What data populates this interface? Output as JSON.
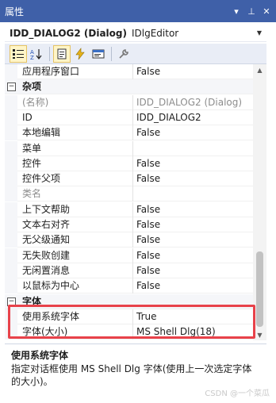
{
  "window": {
    "title": "属性",
    "controls": [
      "▾",
      "⊥",
      "✕"
    ]
  },
  "object_combo": {
    "object_name": "IDD_DIALOG2 (Dialog)",
    "class_name": "IDlgEditor"
  },
  "toolbar": {
    "buttons": [
      "categorized-icon",
      "alphabetical-icon",
      "properties-icon",
      "events-icon",
      "messages-icon",
      "property-pages-icon"
    ],
    "active_index": 2
  },
  "properties": [
    {
      "type": "prop",
      "name": "应用程序窗口",
      "value": "False"
    },
    {
      "type": "cat",
      "name": "杂项"
    },
    {
      "type": "prop",
      "name": "(名称)",
      "value": "IDD_DIALOG2 (Dialog)",
      "disabled": true
    },
    {
      "type": "prop",
      "name": "ID",
      "value": "IDD_DIALOG2"
    },
    {
      "type": "prop",
      "name": "本地编辑",
      "value": "False"
    },
    {
      "type": "prop",
      "name": "菜单",
      "value": ""
    },
    {
      "type": "prop",
      "name": "控件",
      "value": "False"
    },
    {
      "type": "prop",
      "name": "控件父项",
      "value": "False"
    },
    {
      "type": "prop",
      "name": "类名",
      "value": "",
      "disabled": true
    },
    {
      "type": "prop",
      "name": "上下文帮助",
      "value": "False"
    },
    {
      "type": "prop",
      "name": "文本右对齐",
      "value": "False"
    },
    {
      "type": "prop",
      "name": "无父级通知",
      "value": "False"
    },
    {
      "type": "prop",
      "name": "无失败创建",
      "value": "False"
    },
    {
      "type": "prop",
      "name": "无闲置消息",
      "value": "False"
    },
    {
      "type": "prop",
      "name": "以鼠标为中心",
      "value": "False"
    },
    {
      "type": "cat",
      "name": "字体"
    },
    {
      "type": "prop",
      "name": "使用系统字体",
      "value": "True"
    },
    {
      "type": "prop",
      "name": "字体(大小)",
      "value": "MS Shell Dlg(18)"
    }
  ],
  "description": {
    "title": "使用系统字体",
    "text": "指定对话框使用 MS Shell Dlg 字体(使用上一次选定字体的大小)。"
  },
  "watermark": "CSDN @一个菜瓜",
  "colors": {
    "title_bar": "#3f60a8",
    "highlight_border": "#e8424a",
    "toolbar_bg": "#e9edf6"
  }
}
